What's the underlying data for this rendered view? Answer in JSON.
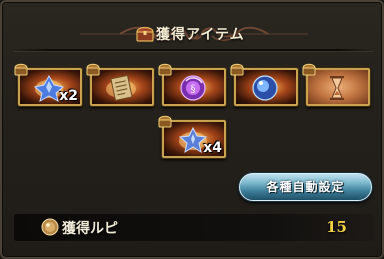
{
  "header": {
    "title": "獲得アイテム"
  },
  "items": [
    {
      "name": "blue-crystal-item",
      "qty": "x2"
    },
    {
      "name": "scroll-item",
      "qty": ""
    },
    {
      "name": "purple-orb-item",
      "qty": ""
    },
    {
      "name": "blue-orb-item",
      "qty": ""
    },
    {
      "name": "hourglass-item",
      "qty": ""
    },
    {
      "name": "star-crystal-item",
      "qty": "x4"
    }
  ],
  "auto_settings_button": {
    "label": "各種自動設定"
  },
  "rupee": {
    "label": "獲得ルピ",
    "value": "15"
  },
  "colors": {
    "accent_gold": "#f2d046",
    "button_blue": "#3e7f9a",
    "item_frame": "#c9a24f"
  }
}
